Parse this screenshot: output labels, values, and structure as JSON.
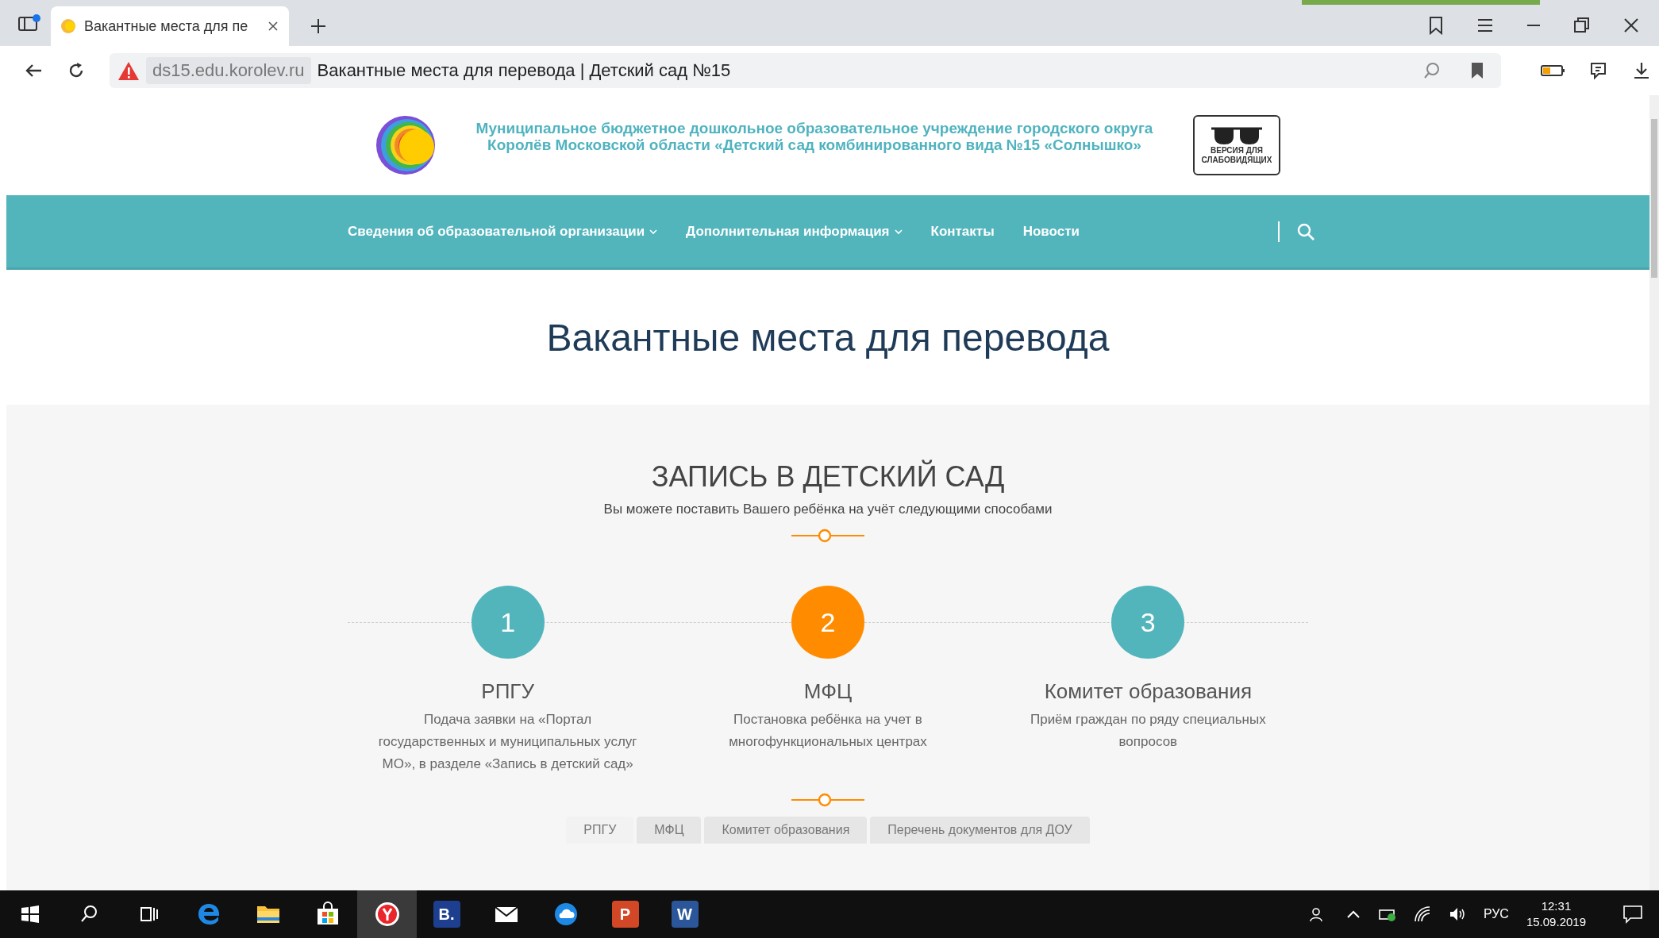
{
  "browser": {
    "tab_title": "Вакантные места для пе",
    "domain": "ds15.edu.korolev.ru",
    "page_title": "Вакантные места для перевода | Детский сад №15"
  },
  "header": {
    "org_name": "Муниципальное бюджетное дошкольное образовательное учреждение городского округа Королёв Московской области «Детский сад комбинированного вида №15 «Солнышко»",
    "accessibility_button": "ВЕРСИЯ ДЛЯ СЛАБОВИДЯЩИХ"
  },
  "nav": {
    "items": [
      {
        "label": "Сведения об образовательной организации",
        "has_dropdown": true
      },
      {
        "label": "Дополнительная информация",
        "has_dropdown": true
      },
      {
        "label": "Контакты",
        "has_dropdown": false
      },
      {
        "label": "Новости",
        "has_dropdown": false
      }
    ]
  },
  "page_title": "Вакантные места для перевода",
  "enrollment": {
    "title": "ЗАПИСЬ В ДЕТСКИЙ САД",
    "subtitle": "Вы можете поставить Вашего ребёнка на учёт следующими способами",
    "steps": [
      {
        "number": "1",
        "title": "РПГУ",
        "text": "Подача заявки на «Портал государственных и муниципальных услуг МО», в разделе «Запись в детский сад»",
        "color": "#52b5bc"
      },
      {
        "number": "2",
        "title": "МФЦ",
        "text": "Постановка ребёнка на учет  в многофункциональных центрах",
        "color": "#ff8c00"
      },
      {
        "number": "3",
        "title": "Комитет образования",
        "text": "Приём граждан по ряду специальных вопросов",
        "color": "#52b5bc"
      }
    ],
    "tabs": [
      {
        "label": "РПГУ",
        "selected": true
      },
      {
        "label": "МФЦ",
        "selected": false
      },
      {
        "label": "Комитет образования",
        "selected": false
      },
      {
        "label": "Перечень документов для ДОУ",
        "selected": false
      }
    ]
  },
  "taskbar": {
    "apps": [
      {
        "kind": "edge"
      },
      {
        "kind": "folder"
      },
      {
        "kind": "store"
      },
      {
        "kind": "yandex"
      },
      {
        "kind": "letter",
        "label": "B.",
        "color": "#1e3f8f"
      },
      {
        "kind": "mail"
      },
      {
        "kind": "cloud"
      },
      {
        "kind": "letter",
        "label": "P",
        "color": "#d24726"
      },
      {
        "kind": "letter",
        "label": "W",
        "color": "#2b579a"
      }
    ],
    "language": "РУС",
    "time": "12:31",
    "date": "15.09.2019"
  }
}
